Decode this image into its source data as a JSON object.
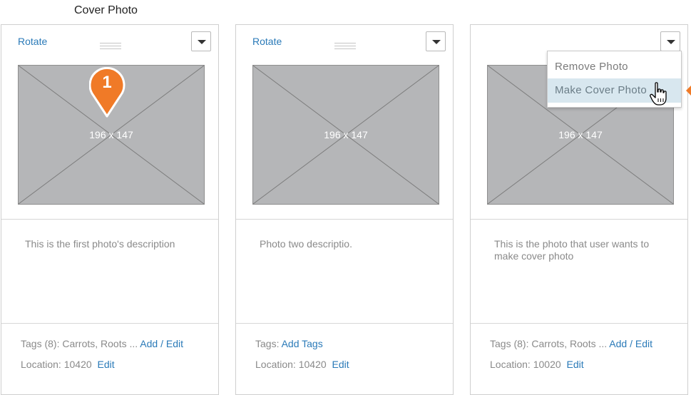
{
  "header": {
    "title": "Cover Photo"
  },
  "cards": [
    {
      "rotate_label": "Rotate",
      "photo_size": "196 x 147",
      "description": "This is the first photo's description",
      "tags_prefix": "Tags (8): Carrots, Roots ...",
      "tags_link": "Add / Edit",
      "location_prefix": "Location: 10420",
      "location_link": "Edit"
    },
    {
      "rotate_label": "Rotate",
      "photo_size": "196 x 147",
      "description": "Photo two descriptio.",
      "tags_prefix": "Tags:",
      "tags_link": "Add Tags",
      "location_prefix": "Location: 10420",
      "location_link": "Edit"
    },
    {
      "photo_size": "196 x 147",
      "description": "This is the photo that user wants to make cover photo",
      "tags_prefix": "Tags (8): Carrots, Roots ...",
      "tags_link": "Add / Edit",
      "location_prefix": "Location: 10020",
      "location_link": "Edit"
    }
  ],
  "dropdown_menu": {
    "items": [
      "Remove Photo",
      "Make Cover Photo"
    ],
    "highlighted_index": 1
  },
  "marker": {
    "number": "1",
    "color": "#f07a27"
  },
  "colors": {
    "link": "#2a7ab8",
    "placeholder": "#b5b6b8",
    "highlight": "#d8e7ef"
  },
  "icons": [
    "chevron-down-icon",
    "drag-handle-icon",
    "image-placeholder-icon",
    "pin-marker-icon",
    "hand-pointer-icon"
  ]
}
